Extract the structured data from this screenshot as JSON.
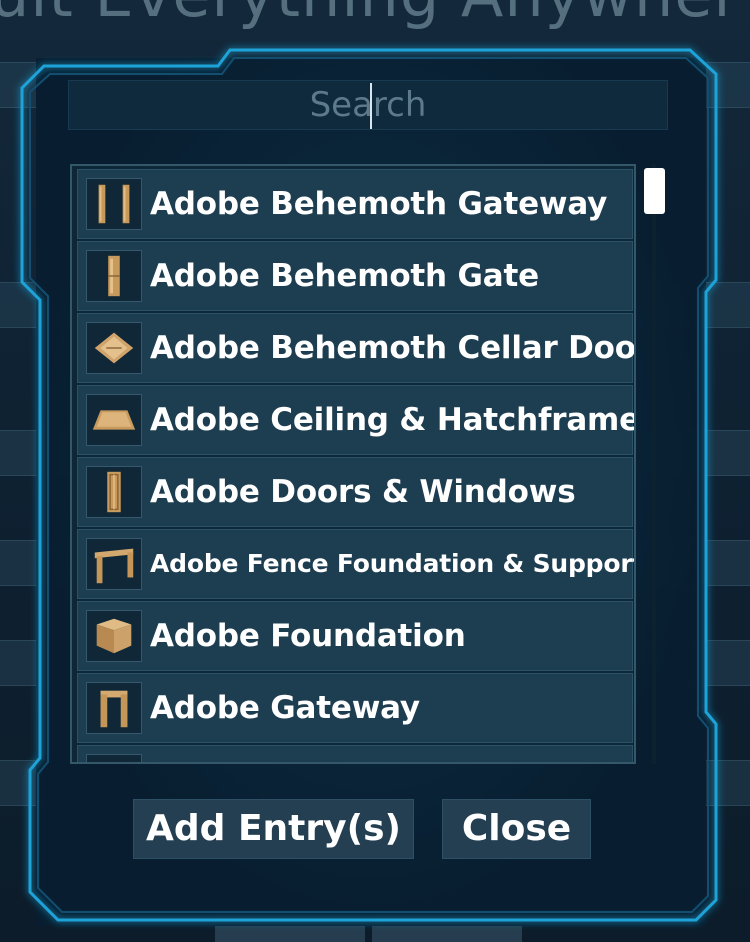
{
  "background": {
    "title": "ult Everything Anywher"
  },
  "search": {
    "placeholder": "Search",
    "value": ""
  },
  "list": {
    "items": [
      {
        "label": "Adobe Behemoth Gateway",
        "icon": "behemoth-gateway-icon"
      },
      {
        "label": "Adobe Behemoth Gate",
        "icon": "behemoth-gate-icon"
      },
      {
        "label": "Adobe Behemoth Cellar Door",
        "icon": "cellar-door-icon"
      },
      {
        "label": "Adobe Ceiling & Hatchframe",
        "icon": "ceiling-icon"
      },
      {
        "label": "Adobe Doors & Windows",
        "icon": "door-icon"
      },
      {
        "label": "Adobe Fence Foundation & Support",
        "icon": "fence-support-icon"
      },
      {
        "label": "Adobe Foundation",
        "icon": "foundation-icon"
      },
      {
        "label": "Adobe Gateway",
        "icon": "gateway-icon"
      }
    ]
  },
  "buttons": {
    "add_entry": "Add Entry(s)",
    "close": "Close"
  },
  "colors": {
    "accent": "#1fa3d8",
    "panel": "#0e2736",
    "row": "#1d3d50",
    "button": "#243f52"
  }
}
